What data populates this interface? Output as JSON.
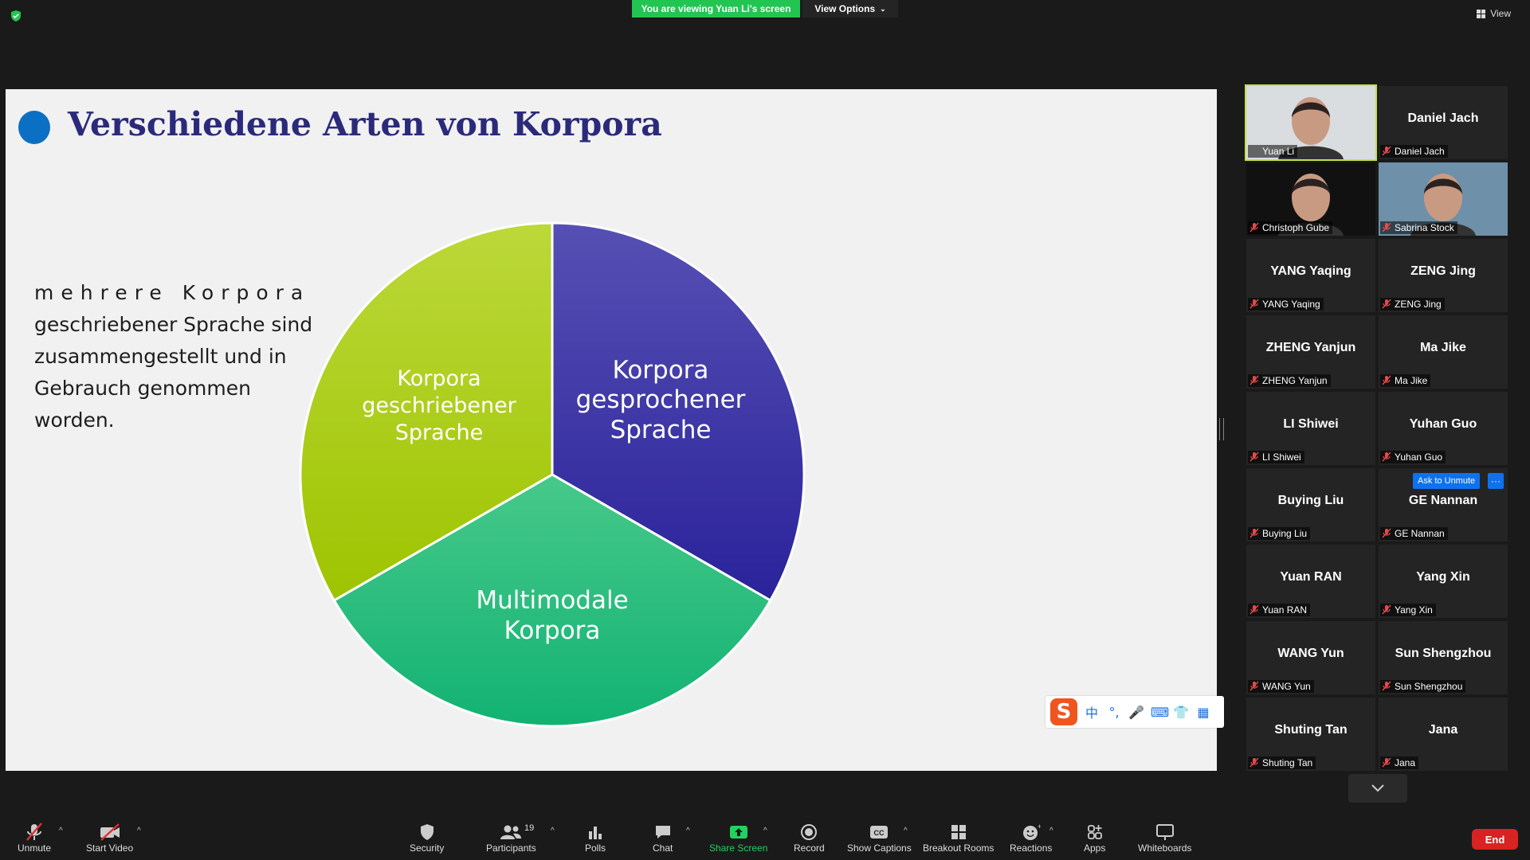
{
  "topbar": {
    "viewing_banner": "You are viewing Yuan Li's screen",
    "view_options": "View Options",
    "view": "View"
  },
  "slide": {
    "title": "Verschiedene Arten von Korpora",
    "text_line1": "mehrere Korpora",
    "text_rest": "geschriebener Sprache sind zusammengestellt und in Gebrauch genommen worden.",
    "pie_labels": {
      "spoken": [
        "Korpora",
        "gesprochener",
        "Sprache"
      ],
      "written": [
        "Korpora",
        "geschriebener",
        "Sprache"
      ],
      "multimodal": [
        "Multimodale",
        "Korpora"
      ]
    },
    "colors": {
      "spoken": "#3a2fa0",
      "written": "#a8cc10",
      "multimodal": "#1fbf7a",
      "title": "#2b2a7a"
    }
  },
  "ime": {
    "logo": "S",
    "items": [
      "中",
      "°,",
      "🎤",
      "⌨",
      "👕",
      "▦"
    ]
  },
  "participants": [
    {
      "name": "Yuan Li",
      "label": "Yuan Li",
      "video": true,
      "speaker": true
    },
    {
      "name": "Daniel Jach",
      "label": "Daniel Jach",
      "video": false
    },
    {
      "name": "Christoph Gube",
      "label": "Christoph Gube",
      "video": true
    },
    {
      "name": "Sabrina Stock",
      "label": "Sabrina Stock",
      "video": true
    },
    {
      "name": "YANG Yaqing",
      "label": "YANG Yaqing",
      "video": false
    },
    {
      "name": "ZENG Jing",
      "label": "ZENG Jing",
      "video": false
    },
    {
      "name": "ZHENG Yanjun",
      "label": "ZHENG Yanjun",
      "video": false
    },
    {
      "name": "Ma Jike",
      "label": "Ma Jike",
      "video": false
    },
    {
      "name": "LI Shiwei",
      "label": "LI Shiwei",
      "video": false
    },
    {
      "name": "Yuhan Guo",
      "label": "Yuhan Guo",
      "video": false
    },
    {
      "name": "Buying Liu",
      "label": "Buying Liu",
      "video": false
    },
    {
      "name": "GE Nannan",
      "label": "GE Nannan",
      "video": false
    },
    {
      "name": "Yuan RAN",
      "label": "Yuan RAN",
      "video": false
    },
    {
      "name": "Yang Xin",
      "label": "Yang Xin",
      "video": false
    },
    {
      "name": "WANG Yun",
      "label": "WANG Yun",
      "video": false
    },
    {
      "name": "Sun Shengzhou",
      "label": "Sun Shengzhou",
      "video": false
    },
    {
      "name": "Shuting Tan",
      "label": "Shuting Tan",
      "video": false
    },
    {
      "name": "Jana",
      "label": "Jana",
      "video": false
    }
  ],
  "ask_unmute": "Ask to Unmute",
  "ask_more": "···",
  "toolbar": {
    "unmute": "Unmute",
    "start_video": "Start Video",
    "security": "Security",
    "participants": "Participants",
    "participants_count": "19",
    "polls": "Polls",
    "chat": "Chat",
    "share_screen": "Share Screen",
    "record": "Record",
    "show_captions": "Show Captions",
    "breakout_rooms": "Breakout Rooms",
    "reactions": "Reactions",
    "apps": "Apps",
    "whiteboards": "Whiteboards",
    "end": "End"
  }
}
